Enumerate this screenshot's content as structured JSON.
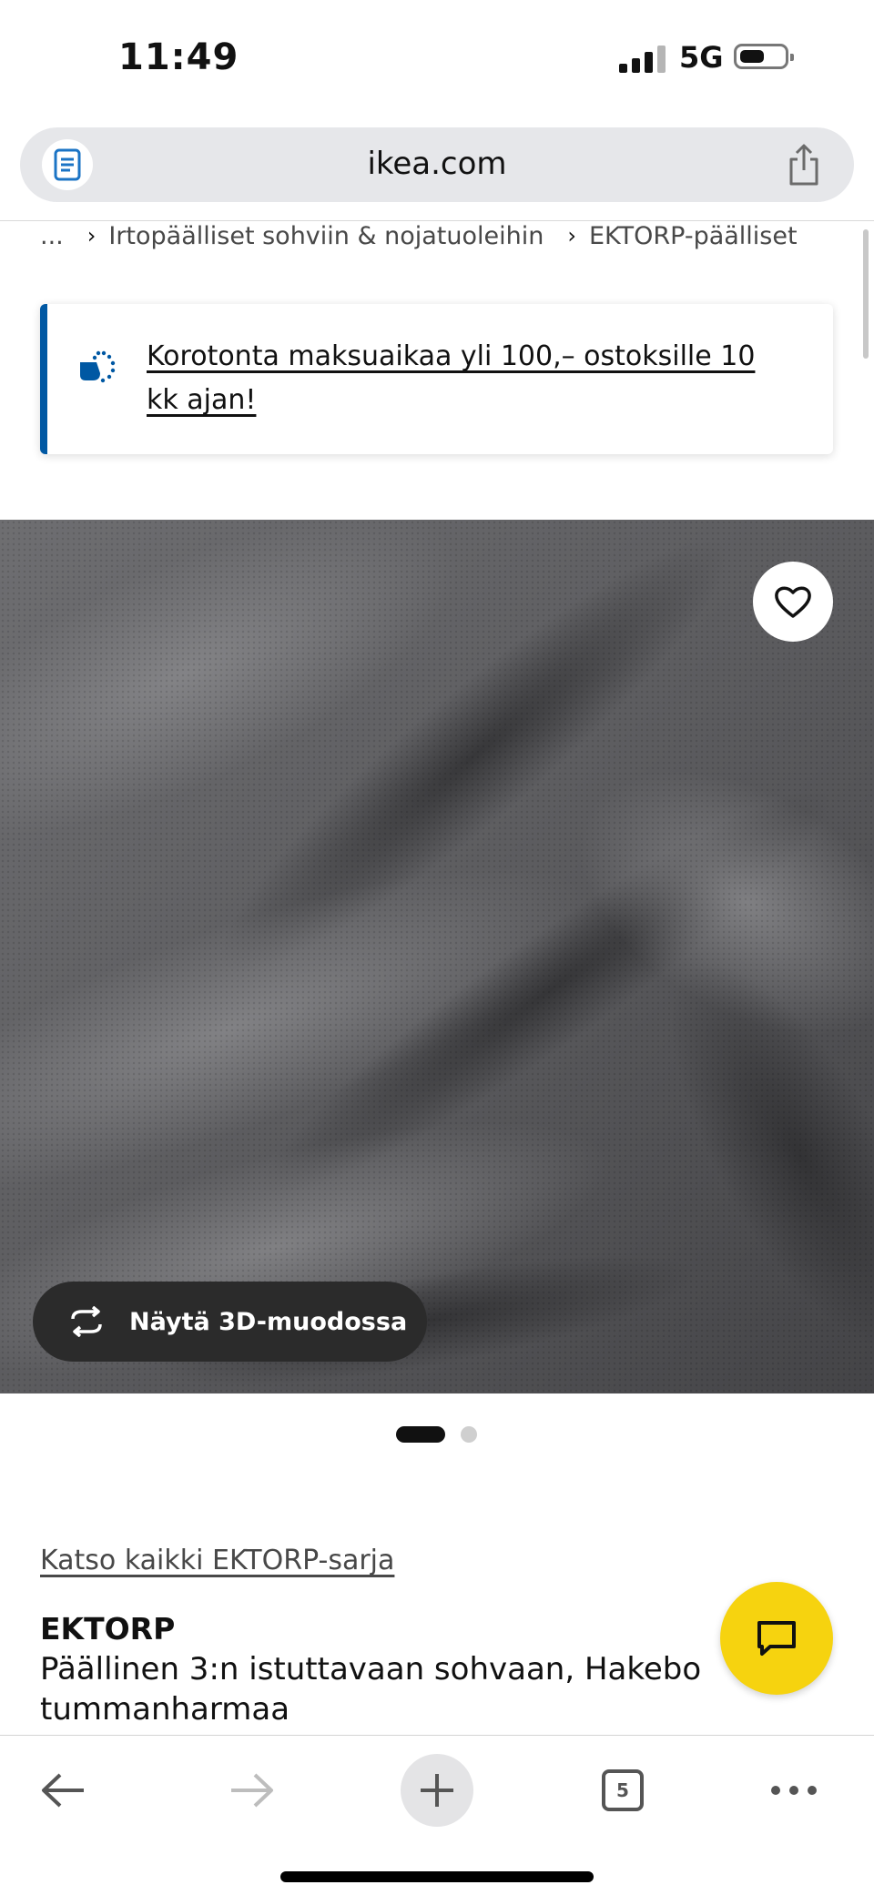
{
  "status_bar": {
    "time": "11:49",
    "network": "5G",
    "battery_level": 0.5
  },
  "address_bar": {
    "url": "ikea.com",
    "reader_icon": "reader-icon",
    "share_icon": "share-icon"
  },
  "breadcrumb": {
    "items": [
      "...",
      "Irtopäälliset sohviin & nojatuoleihin",
      "EKTORP-päälliset"
    ]
  },
  "promo": {
    "icon": "payment-time-icon",
    "text": "Korotonta maksuaikaa yli 100,– ostoksille 10 kk ajan!",
    "accent_color": "#0058a3"
  },
  "hero": {
    "favorite_icon": "heart-icon",
    "view_3d_label": "Näytä 3D-muodossa",
    "view_3d_icon": "rotate-3d-icon",
    "image_count": 2,
    "active_image": 1
  },
  "product": {
    "range_link": "Katso kaikki EKTORP-sarja",
    "name": "EKTORP",
    "description": "Päällinen 3:n istuttavaan sohvaan, Hakebo tummanharmaa"
  },
  "chat": {
    "icon": "chat-icon",
    "color": "#f6d30f"
  },
  "toolbar": {
    "back_icon": "back-arrow-icon",
    "forward_icon": "forward-arrow-icon",
    "new_tab_icon": "plus-icon",
    "tab_count": "5",
    "more_icon": "more-icon"
  }
}
